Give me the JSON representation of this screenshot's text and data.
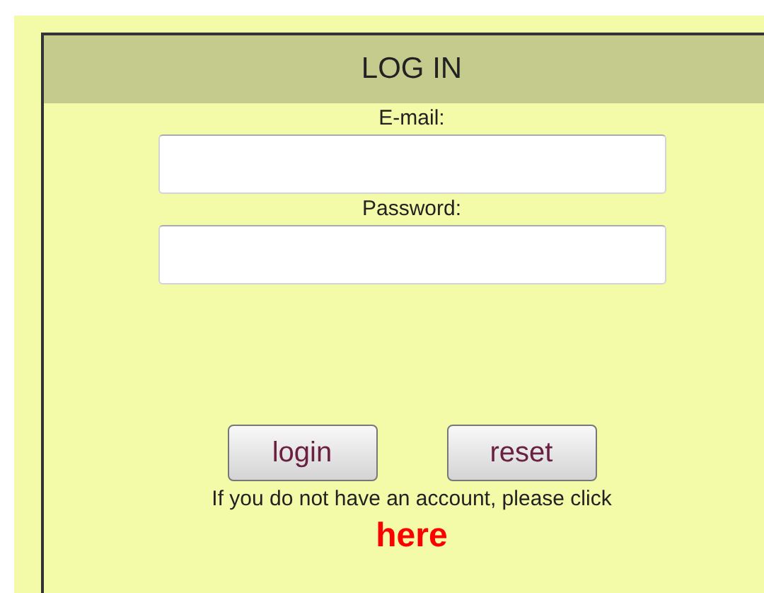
{
  "title": "LOG IN",
  "fields": [
    {
      "label": "E-mail:"
    },
    {
      "label": "Password:"
    }
  ],
  "buttons": [
    "login",
    "reset"
  ],
  "note": "If you do not have an account, please click",
  "link": "here"
}
